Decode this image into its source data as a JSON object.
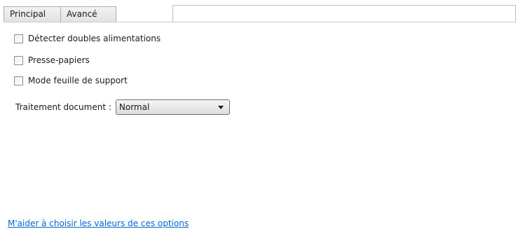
{
  "tabs": [
    {
      "label": "Principal",
      "active": false
    },
    {
      "label": "Avancé",
      "active": true
    }
  ],
  "options": [
    {
      "label": "Détecter doubles alimentations",
      "checked": false
    },
    {
      "label": "Presse-papiers",
      "checked": false
    },
    {
      "label": "Mode feuille de support",
      "checked": false
    }
  ],
  "processing": {
    "label": "Traitement document :",
    "value": "Normal"
  },
  "help_link": "M'aider à choisir les valeurs de ces options"
}
